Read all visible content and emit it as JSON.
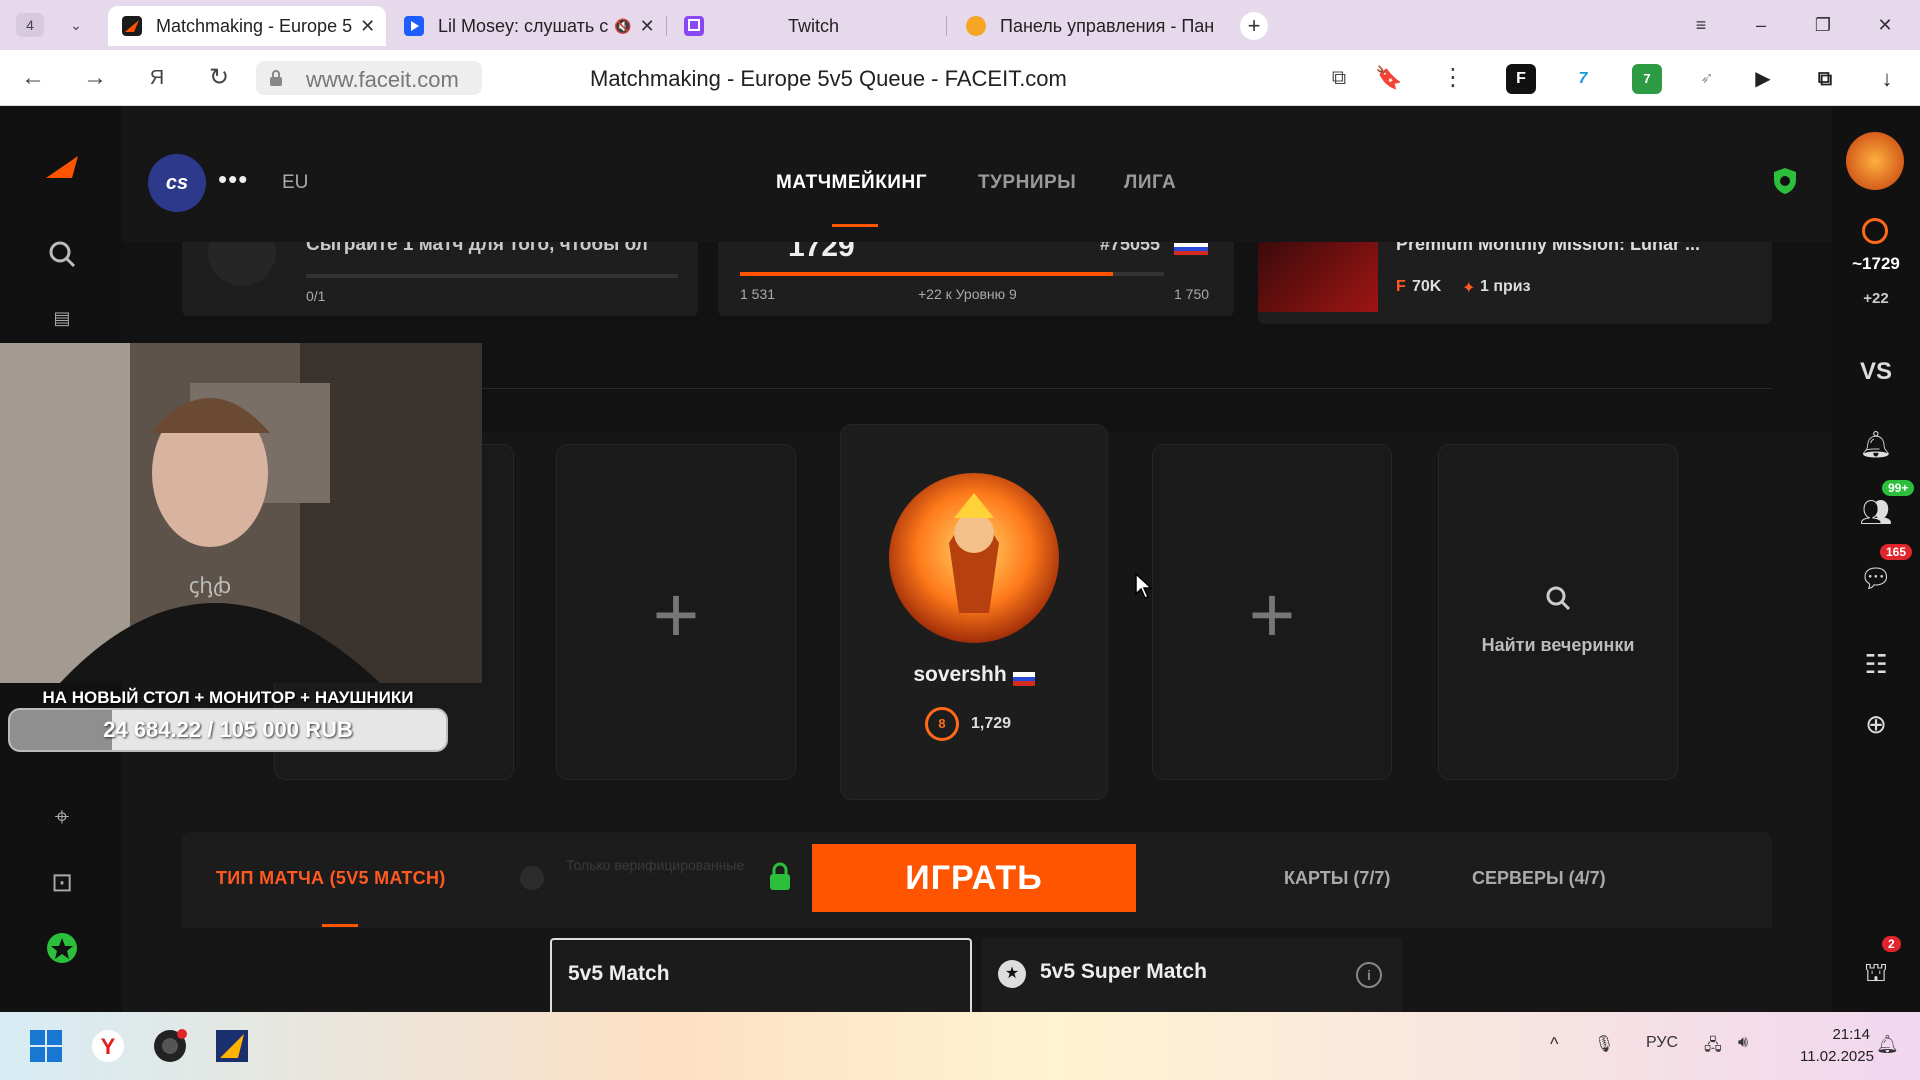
{
  "browser": {
    "tab_count": "4",
    "tabs": [
      {
        "label": "Matchmaking - Europe 5",
        "active": true
      },
      {
        "label": "Lil Mosey: слушать с",
        "active": false
      },
      {
        "label": "Twitch",
        "active": false
      },
      {
        "label": "Панель управления - Пан",
        "active": false
      }
    ],
    "url": "www.faceit.com",
    "page_title": "Matchmaking - Europe 5v5 Queue - FACEIT.com",
    "extension_badge": "7"
  },
  "header": {
    "game_badge": "cs",
    "menu_dots": "•••",
    "region": "EU",
    "nav": [
      "МАТЧМЕЙКИНГ",
      "ТУРНИРЫ",
      "ЛИГА"
    ]
  },
  "missions": {
    "mission_text": "Сыграйте 1 матч для того, чтобы ол",
    "mission_progress": "0/1",
    "elo_current": "1729",
    "rank": "#75055",
    "elo_min": "1 531",
    "elo_next": "+22 к Уровню 9",
    "elo_max": "1 750",
    "elo_progress": 0.88,
    "premium_title": "Premium Monthly Mission: Lunar ...",
    "premium_reward": "70K",
    "premium_prize": "1 приз"
  },
  "party": {
    "player_name": "sovershh",
    "player_level": "8",
    "player_elo": "1,729",
    "find_parties": "Найти вечеринки"
  },
  "queue": {
    "match_type": "ТИП МАТЧА (5V5 MATCH)",
    "verified_note": "Только верифицированные",
    "play": "ИГРАТЬ",
    "maps": "КАРТЫ (7/7)",
    "servers": "СЕРВЕРЫ (4/7)",
    "mode_selected": "5v5 Match",
    "mode_other": "5v5 Super Match"
  },
  "right_rail": {
    "elo": "1729",
    "elo_delta": "+22",
    "vs": "VS",
    "friends_badge": "99+",
    "chat_badge": "165",
    "store_badge": "2"
  },
  "stream_overlay": {
    "goal_title": "НА НОВЫЙ СТОЛ + МОНИТОР + НАУШНИКИ",
    "goal_amount": "24 684.22 / 105 000 RUB",
    "goal_progress": 0.235
  },
  "taskbar": {
    "lang": "РУС",
    "time": "21:14",
    "date": "11.02.2025"
  },
  "colors": {
    "accent": "#ff5500",
    "background": "#161616"
  }
}
